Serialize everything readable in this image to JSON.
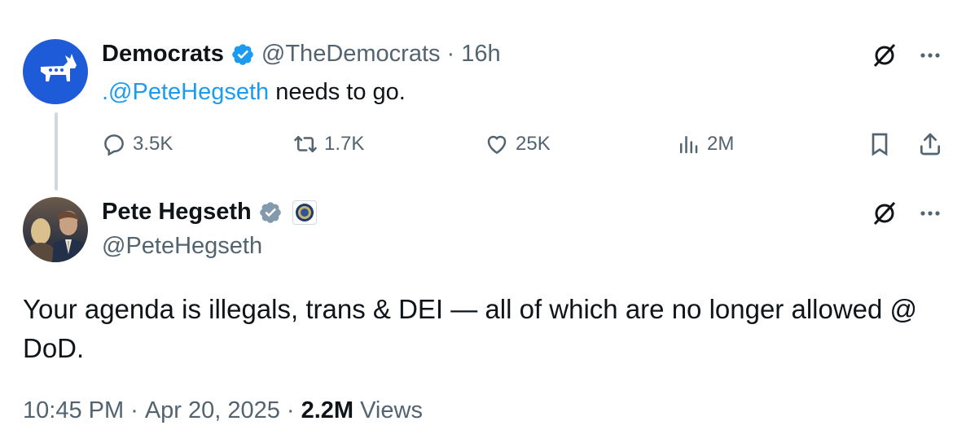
{
  "tweet_parent": {
    "name": "Democrats",
    "handle": "@TheDemocrats",
    "separator": "·",
    "time": "16h",
    "text_mention": ".@PeteHegseth",
    "text_rest": " needs to go.",
    "stats": {
      "replies": "3.5K",
      "reposts": "1.7K",
      "likes": "25K",
      "views": "2M"
    }
  },
  "tweet_main": {
    "name": "Pete Hegseth",
    "handle": "@PeteHegseth",
    "text": "Your agenda is illegals, trans & DEI — all of which are no longer allowed @ DoD.",
    "time": "10:45 PM",
    "date": "Apr 20, 2025",
    "separator": "·",
    "views_count": "2.2M",
    "views_label": "Views"
  },
  "colors": {
    "accent": "#1d9bf0",
    "text": "#0f1419",
    "muted": "#536471",
    "democrats_blue": "#1d5bd8",
    "verified_gray": "#829aab"
  },
  "icons": [
    "grok-icon",
    "more-icon",
    "reply-icon",
    "repost-icon",
    "like-icon",
    "views-icon",
    "bookmark-icon",
    "share-icon",
    "verified-badge-icon",
    "dod-seal-icon"
  ]
}
